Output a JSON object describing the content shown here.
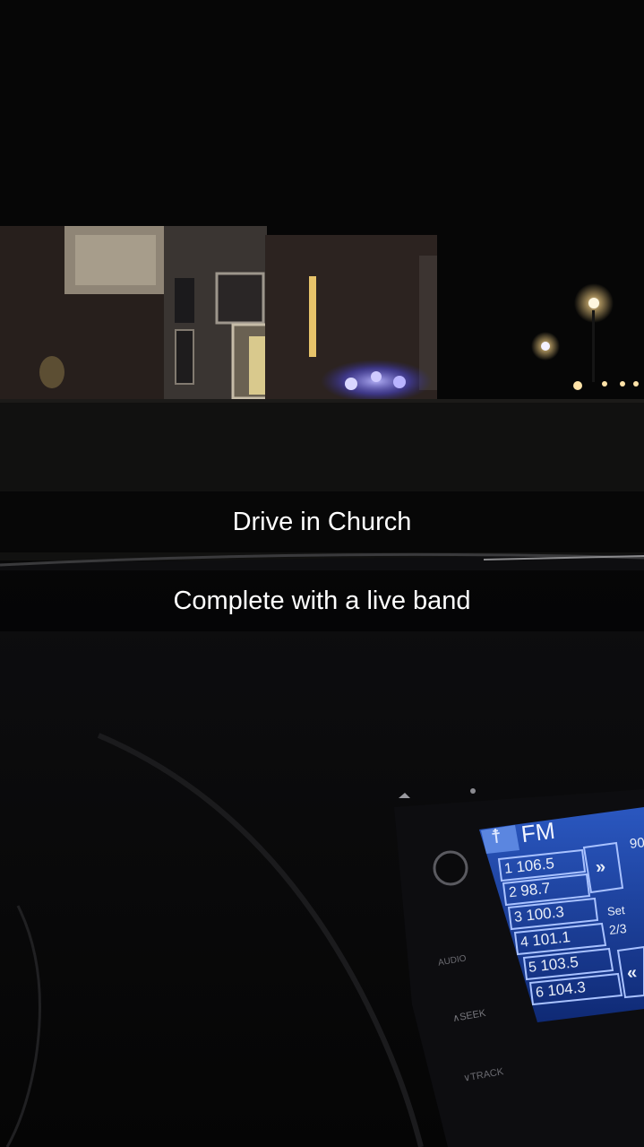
{
  "captions": {
    "line1": "Drive in Church",
    "line2": "Complete with a live band"
  },
  "radio": {
    "band": "FM",
    "presets": [
      {
        "num": "1",
        "freq": "106.5"
      },
      {
        "num": "2",
        "freq": "98.7"
      },
      {
        "num": "3",
        "freq": "100.3"
      },
      {
        "num": "4",
        "freq": "101.1"
      },
      {
        "num": "5",
        "freq": "103.5"
      },
      {
        "num": "6",
        "freq": "104.3"
      }
    ],
    "next_symbol": "»",
    "prev_symbol": "«",
    "set_label": "Set",
    "set_page": "2/3",
    "partial_freq": "90",
    "audio_label": "AUDIO",
    "seek_label": "∧SEEK",
    "track_label": "∨TRACK"
  },
  "colors": {
    "sky": "#060606",
    "building": "#2a211e",
    "window_light": "#d8c98a",
    "band_lights": "#6f6bff",
    "screen_blue": "#1c3f9a",
    "caption_bg": "rgba(0,0,0,0.55)"
  }
}
